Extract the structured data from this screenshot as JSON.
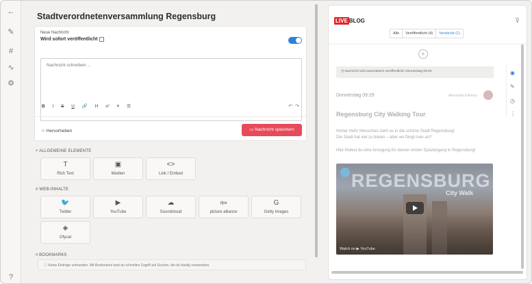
{
  "editor": {
    "title": "Stadtverordnetenversammlung Regensburg",
    "new_message_label": "Neue Nachricht",
    "publish_mode": "Wird sofort veröffentlicht",
    "placeholder": "Nachricht schreiben ...",
    "highlight_label": "Hervorheben",
    "save_label": "Nachricht speichern",
    "toggle_on": true,
    "format_tools": [
      "B",
      "I",
      "S",
      "U",
      "🔗",
      "H",
      "x²",
      "≡",
      "☰"
    ]
  },
  "sections": {
    "general": {
      "label": "+ ALLGEMEINE ELEMENTE",
      "items": [
        {
          "label": "Rich Text",
          "icon": "text-icon"
        },
        {
          "label": "Medien",
          "icon": "image-icon"
        },
        {
          "label": "Link / Embed",
          "icon": "code-icon"
        }
      ]
    },
    "web": {
      "label": "# WEB-INHALTE",
      "items": [
        {
          "label": "Twitter",
          "icon": "twitter-icon"
        },
        {
          "label": "YouTube",
          "icon": "youtube-icon"
        },
        {
          "label": "Soundcloud",
          "icon": "soundcloud-icon"
        },
        {
          "label": "picture alliance",
          "icon": "picture-alliance-icon"
        },
        {
          "label": "Getty Images",
          "icon": "getty-icon"
        },
        {
          "label": "Gfycat",
          "icon": "gfycat-icon"
        }
      ]
    },
    "bookmarks": {
      "label": "BOOKMARKS",
      "empty_text": "Keine Einträge vorhanden. Mit Bookmarks hast du schnellen Zugriff auf Suchen, die du häufig verwendest."
    }
  },
  "blog": {
    "logo_live": "LIVE",
    "logo_blog": "BLOG",
    "filters": [
      "Alle",
      "Veröffentlicht (4)",
      "Versteckt (1)"
    ],
    "notice": "Nachricht wird automatisch veröffentlicht: Donnerstag 09:29",
    "post_time": "Donnerstag 09:29",
    "post_author": "Alexander Edelenz",
    "post_title": "Regensburg City Walking Tour",
    "post_line1": "Immer mehr Menschen zieht es in die schöne Stadt Regensburg!",
    "post_line2": "Die Stadt hat viel zu bieten – aber wo fängt man an?",
    "post_line3": "Hier findest du eine Anregung für deinen ersten Spaziergang in Regensburg!",
    "video_title": "REGENSBURG",
    "video_subtitle": "City Walk",
    "video_footer": "Watch on  ▶ YouTube"
  },
  "colors": {
    "accent_blue": "#2e7fd9",
    "save_red": "#e74a5a",
    "live_red": "#e1262d"
  }
}
